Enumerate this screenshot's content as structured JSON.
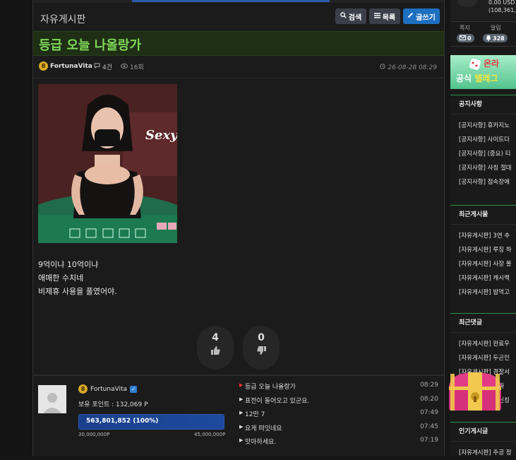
{
  "board": {
    "title": "자유게시판",
    "buttons": {
      "search": "검색",
      "list": "목록",
      "write": "글쓰기"
    }
  },
  "post": {
    "title": "등급 오늘 나올랑가",
    "author": "FortunaVita",
    "author_level": "8",
    "comments": "4건",
    "views": "16회",
    "date": "26-08-28 08:29",
    "image_caption": "Sexy",
    "body_lines": [
      "9억이냐 10억이냐",
      "애매한 수치네",
      "비제휴 사용을 풀였어야."
    ],
    "likes": "4",
    "dislikes": "0"
  },
  "profile": {
    "name": "FortunaVita",
    "level": "8",
    "points_text": "보유 포인트 : 132,069 P",
    "progress_label": "563,801,852 (100%)",
    "progress_percent": 100,
    "progress_min": "30,000,000P",
    "progress_max": "45,000,000P"
  },
  "recent_posts": [
    {
      "title": "등급 오늘 나올랑가",
      "time": "08:29",
      "current": true
    },
    {
      "title": "표전이 돌어오고 있군요.",
      "time": "08:20",
      "current": false
    },
    {
      "title": "12만 7",
      "time": "07:49",
      "current": false
    },
    {
      "title": "요게 떠잇네요",
      "time": "07:45",
      "current": false
    },
    {
      "title": "맛아하세요.",
      "time": "07:19",
      "current": false
    }
  ],
  "sidebar": {
    "balance_line1": "0.00 USD",
    "balance_line2": "(108,361,",
    "tab_note": "쪽지",
    "tab_alert": "알림",
    "note_count": "0",
    "alert_count": "328",
    "banner_line1": "온라",
    "banner_line2_a": "공식 ",
    "banner_line2_b": "텔레그",
    "notice_title": "공지사항",
    "notice_items": [
      "[공지사항] 휴카지노",
      "[공지사항] 사이트다",
      "[공지사항] (중요) 티",
      "[공지사항] 사칭 절대",
      "[공지사항] 접속장애"
    ],
    "recent_title": "최근게시물",
    "recent_items": [
      "[자유게시판] 3연 추",
      "[자유게시판] 루징 하",
      "[자유게시판] 사장 몰",
      "[자유게시판] 캐시백",
      "[자유게시판] 밥먹고"
    ],
    "comments_title": "최근댓글",
    "comment_items": [
      "[자유게시판] 완료우",
      "[자유게시판] 두곤인",
      "[자유게시판] 경찰서",
      "[자유게시판] 진짜 ",
      "[자유게시판] 새신칭"
    ],
    "popular_title": "인기게시글",
    "popular_items": [
      "[자유게시판] 주공 정"
    ]
  },
  "colors": {
    "title_green": "#7fd858",
    "write_blue": "#1e6fbf",
    "accent_green": "#2e8f4b",
    "progress_blue": "#1d4a9e"
  }
}
